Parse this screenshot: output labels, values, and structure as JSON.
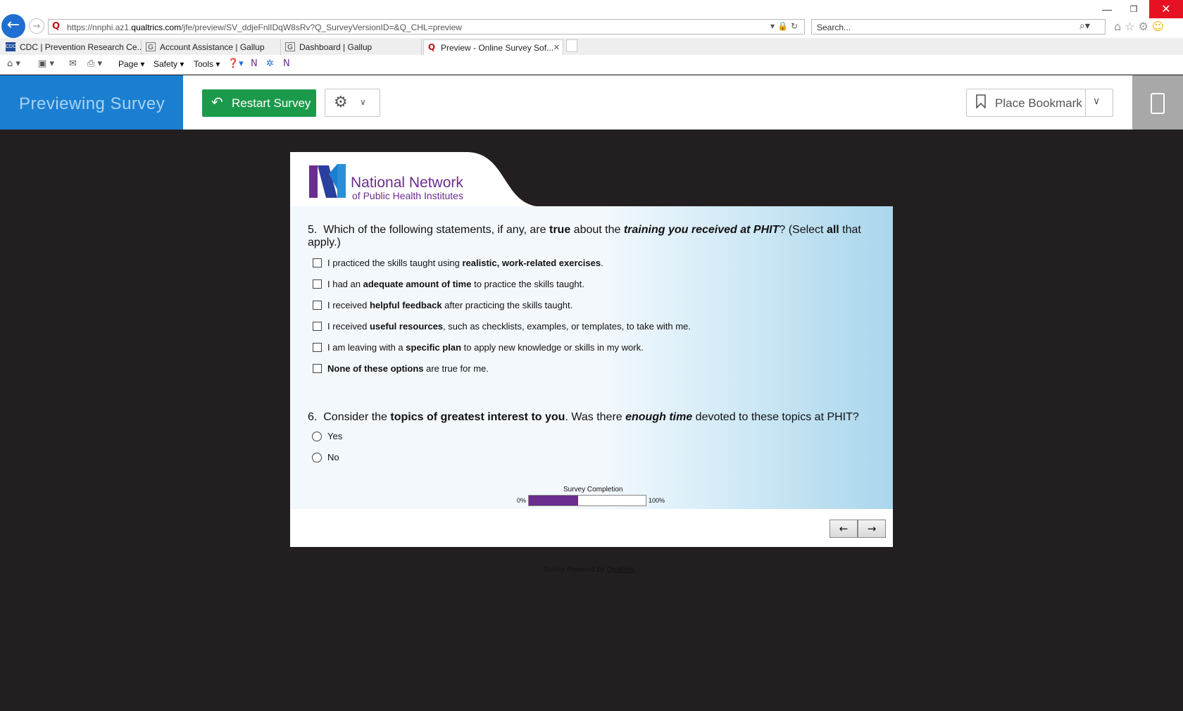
{
  "browser": {
    "url_prefix": "https://nnphi.az1.",
    "url_domain": "qualtrics.com",
    "url_path": "/jfe/preview/SV_ddjeFnlIDqW8sRv?Q_SurveyVersionID=&Q_CHL=preview",
    "search_placeholder": "Search...",
    "tabs": [
      {
        "icon": "CDC",
        "label": "CDC | Prevention Research Ce..."
      },
      {
        "icon": "G",
        "label": "Account Assistance | Gallup"
      },
      {
        "icon": "G",
        "label": "Dashboard | Gallup"
      },
      {
        "icon": "Q",
        "label": "Preview - Online Survey Sof..."
      }
    ],
    "command_bar": {
      "page": "Page",
      "safety": "Safety",
      "tools": "Tools"
    }
  },
  "preview_bar": {
    "title": "Previewing Survey",
    "restart_label": "Restart Survey",
    "bookmark_label": "Place Bookmark"
  },
  "logo": {
    "line1": "National Network",
    "line2": "of Public Health Institutes",
    "color": "#6b2c8f"
  },
  "q5": {
    "number": "5.",
    "text_parts": [
      "Which of the following statements, if any, are ",
      "true",
      " about the ",
      "training you received at PHIT",
      "? (Select ",
      "all",
      " that apply.)"
    ],
    "options": [
      {
        "pre": "I practiced the skills taught using ",
        "bold": "realistic, work-related exercises",
        "post": "."
      },
      {
        "pre": "I had an ",
        "bold": "adequate amount of time",
        "post": " to practice the skills taught."
      },
      {
        "pre": "I received ",
        "bold": "helpful feedback",
        "post": " after practicing the skills taught."
      },
      {
        "pre": "I received ",
        "bold": "useful resources",
        "post": ", such as checklists, examples, or templates, to take with me."
      },
      {
        "pre": "I am leaving with a ",
        "bold": "specific plan",
        "post": " to apply new knowledge or skills in my work."
      },
      {
        "pre": "",
        "bold": "None of these options",
        "post": " are true for me."
      }
    ]
  },
  "q6": {
    "number": "6.",
    "text_parts": [
      "Consider the ",
      "topics of greatest interest to you",
      ". Was there ",
      "enough time",
      " devoted to these topics at PHIT?"
    ],
    "options": [
      "Yes",
      "No"
    ]
  },
  "progress": {
    "title": "Survey Completion",
    "min_label": "0%",
    "max_label": "100%",
    "value": 0.42,
    "color": "#6b2c8f"
  },
  "nav": {
    "prev": "←",
    "next": "→"
  },
  "footer": {
    "powered_text": "Survey Powered By ",
    "powered_link": "Qualtrics"
  },
  "colors": {
    "accent_blue": "#1a7fd0",
    "restart_green": "#1c9a4b",
    "page_bg": "#231f20"
  }
}
